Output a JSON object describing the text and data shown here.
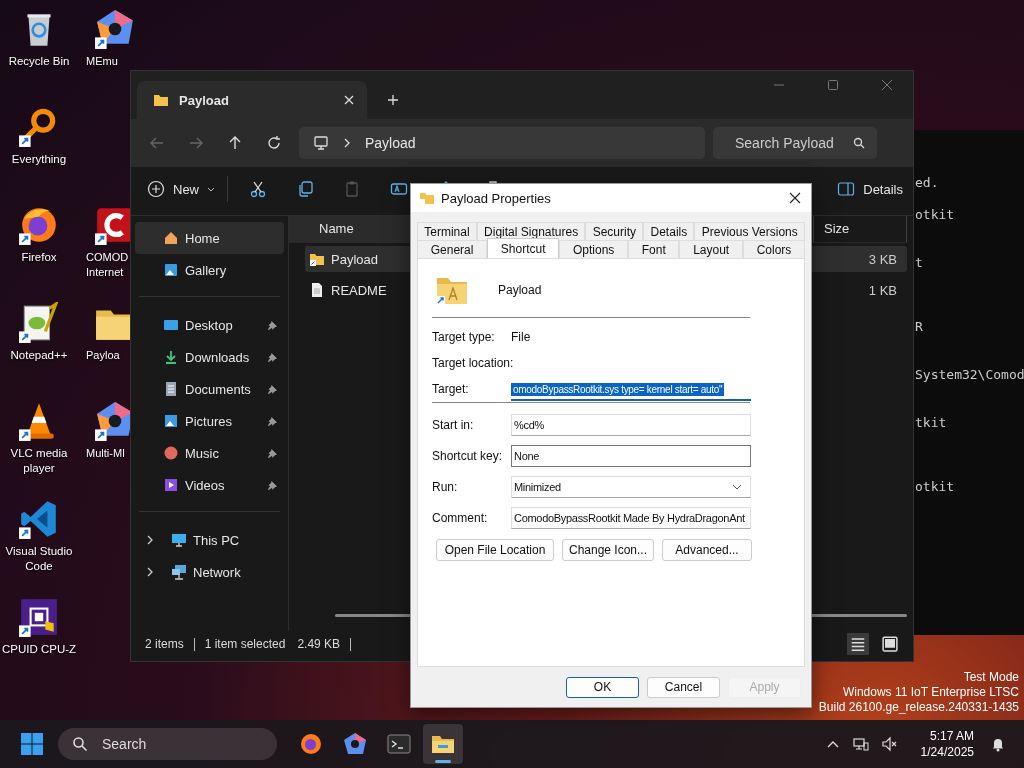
{
  "desktop": {
    "icons_left": [
      {
        "label": "Recycle Bin",
        "kind": "bin",
        "shortcut": false
      },
      {
        "label": "Everything",
        "kind": "magnifier",
        "shortcut": true
      },
      {
        "label": "Firefox",
        "kind": "firefox",
        "shortcut": true
      },
      {
        "label": "Notepad++",
        "kind": "notepad",
        "shortcut": true
      },
      {
        "label": "VLC media player",
        "kind": "cone",
        "shortcut": true
      },
      {
        "label": "Visual Studio Code",
        "kind": "vscode",
        "shortcut": true
      },
      {
        "label": "CPUID CPU-Z",
        "kind": "chip",
        "shortcut": true
      }
    ],
    "icons_right": [
      {
        "label": "MEmu",
        "kind": "memu",
        "shortcut": true
      },
      {
        "label": "COMOD Internet",
        "kind": "comodo",
        "shortcut": true
      },
      {
        "label": "Payloa",
        "kind": "folder",
        "shortcut": false
      },
      {
        "label": "Multi-MI",
        "kind": "memu",
        "shortcut": true
      }
    ],
    "info": [
      "Test Mode",
      "Windows 11 IoT Enterprise LTSC",
      "Build 26100.ge_release.240331-1435"
    ]
  },
  "terminal": {
    "lines": [
      "ed.",
      "otkit",
      "t",
      "R",
      "System32\\Comod",
      "tkit",
      "otkit"
    ]
  },
  "explorer": {
    "tab_title": "Payload",
    "address": "Payload",
    "search_placeholder": "Search Payload",
    "toolbar": {
      "new_label": "New",
      "details_label": "Details"
    },
    "sidebar": {
      "top": [
        {
          "label": "Home",
          "kind": "home",
          "selected": true
        },
        {
          "label": "Gallery",
          "kind": "gallery",
          "selected": false
        }
      ],
      "pinned": [
        {
          "label": "Desktop",
          "kind": "desktop",
          "pinned": true
        },
        {
          "label": "Downloads",
          "kind": "downloads",
          "pinned": true
        },
        {
          "label": "Documents",
          "kind": "documents",
          "pinned": true
        },
        {
          "label": "Pictures",
          "kind": "pictures",
          "pinned": true
        },
        {
          "label": "Music",
          "kind": "music",
          "pinned": true
        },
        {
          "label": "Videos",
          "kind": "videos",
          "pinned": true
        }
      ],
      "locations": [
        {
          "label": "This PC",
          "kind": "pc",
          "expanded": false
        },
        {
          "label": "Network",
          "kind": "network",
          "expanded": false
        }
      ]
    },
    "columns": [
      "Name",
      "Size"
    ],
    "files": [
      {
        "name": "Payload",
        "size": "3 KB",
        "kind": "shortcut",
        "selected": true
      },
      {
        "name": "README",
        "size": "1 KB",
        "kind": "text",
        "selected": false
      }
    ],
    "status": {
      "count": "2 items",
      "selection": "1 item selected",
      "size": "2.49 KB"
    }
  },
  "dialog": {
    "title": "Payload Properties",
    "tab_rows": [
      [
        {
          "label": "Terminal",
          "selected": false
        },
        {
          "label": "Digital Signatures",
          "selected": false
        },
        {
          "label": "Security",
          "selected": false
        },
        {
          "label": "Details",
          "selected": false
        },
        {
          "label": "Previous Versions",
          "selected": false
        }
      ],
      [
        {
          "label": "General",
          "selected": false
        },
        {
          "label": "Shortcut",
          "selected": true
        },
        {
          "label": "Options",
          "selected": false
        },
        {
          "label": "Font",
          "selected": false
        },
        {
          "label": "Layout",
          "selected": false
        },
        {
          "label": "Colors",
          "selected": false
        }
      ]
    ],
    "name": "Payload",
    "info_rows": [
      {
        "label": "Target type:",
        "value": "File",
        "kind": "text"
      },
      {
        "label": "Target location:",
        "kind": "text"
      },
      {
        "label": "Target:",
        "value": "omodoBypassRootkit.sys type= kernel start= auto\"",
        "kind": "input",
        "highlighted": true
      }
    ],
    "fields": [
      {
        "label": "Start in:",
        "value": "%cd%",
        "kind": "input"
      },
      {
        "label": "Shortcut key:",
        "value": "None",
        "kind": "hotkey"
      },
      {
        "label": "Run:",
        "value": "Minimized",
        "kind": "select"
      },
      {
        "label": "Comment:",
        "value": "ComodoBypassRootkit Made By HydraDragonAnt",
        "kind": "input"
      }
    ],
    "actions": [
      "Open File Location",
      "Change Icon...",
      "Advanced..."
    ],
    "footer": [
      {
        "label": "OK",
        "default": true,
        "disabled": false
      },
      {
        "label": "Cancel",
        "default": false,
        "disabled": false
      },
      {
        "label": "Apply",
        "default": false,
        "disabled": true
      }
    ]
  },
  "taskbar": {
    "search_placeholder": "Search",
    "apps": [
      {
        "kind": "firefox",
        "active": false
      },
      {
        "kind": "memu",
        "active": false
      },
      {
        "kind": "terminal",
        "active": false
      },
      {
        "kind": "explorer",
        "active": true
      }
    ],
    "time": "5:17 AM",
    "date": "1/24/2025"
  }
}
